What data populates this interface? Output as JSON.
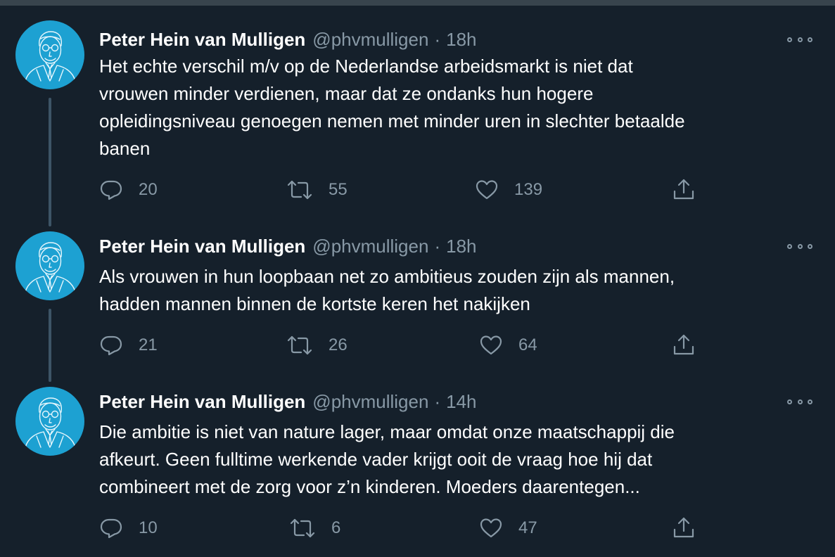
{
  "colors": {
    "background": "#15202b",
    "avatar_bg": "#1da1d2",
    "secondary_text": "#8899a6",
    "thread_line": "#3d5466"
  },
  "tweets": [
    {
      "author_name": "Peter Hein van Mulligen",
      "handle": "@phvmulligen",
      "separator": "·",
      "time": "18h",
      "text": "Het echte verschil m/v op de Nederlandse arbeidsmarkt is niet dat\nvrouwen minder verdienen, maar dat ze ondanks hun hogere\nopleidingsniveau genoegen nemen met minder uren in slechter betaalde\nbanen",
      "replies": "20",
      "retweets": "55",
      "likes": "139",
      "icons": [
        "reply-icon",
        "retweet-icon",
        "like-icon",
        "share-icon",
        "more-icon"
      ]
    },
    {
      "author_name": "Peter Hein van Mulligen",
      "handle": "@phvmulligen",
      "separator": "·",
      "time": "18h",
      "text": "Als vrouwen in hun loopbaan net zo ambitieus zouden zijn als mannen,\nhadden mannen binnen de kortste keren het nakijken",
      "replies": "21",
      "retweets": "26",
      "likes": "64",
      "icons": [
        "reply-icon",
        "retweet-icon",
        "like-icon",
        "share-icon",
        "more-icon"
      ]
    },
    {
      "author_name": "Peter Hein van Mulligen",
      "handle": "@phvmulligen",
      "separator": "·",
      "time": "14h",
      "text": "Die ambitie is niet van nature lager, maar omdat onze maatschappij die\nafkeurt. Geen fulltime werkende vader krijgt ooit de vraag hoe hij dat\ncombineert met de zorg voor z’n kinderen. Moeders daarentegen...",
      "replies": "10",
      "retweets": "6",
      "likes": "47",
      "icons": [
        "reply-icon",
        "retweet-icon",
        "like-icon",
        "share-icon",
        "more-icon"
      ]
    }
  ]
}
